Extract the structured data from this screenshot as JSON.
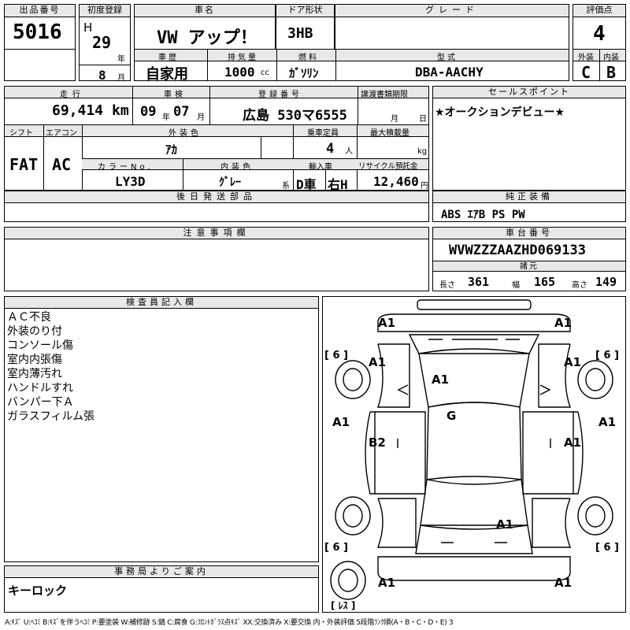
{
  "headers": {
    "lot_no": "出品番号",
    "first_reg": "初度登録",
    "car_name": "車名",
    "door": "ドア形状",
    "grade": "グレード",
    "score": "評価点",
    "history": "車歴",
    "displacement": "排気量",
    "fuel": "燃料",
    "model": "型式",
    "exterior": "外装",
    "interior": "内装",
    "mileage": "走行",
    "inspection": "車検",
    "reg_no": "登録番号",
    "transfer": "譲渡書類期限",
    "sales_point": "セールスポイント",
    "shift": "シフト",
    "aircon": "エアコン",
    "ext_color": "外装色",
    "capacity": "乗車定員",
    "max_load": "最大積載量",
    "color_no": "カラーNo.",
    "int_color": "内装色",
    "import": "輸入車",
    "recycle": "リサイクル預託金",
    "later_parts": "後日発送部品",
    "genuine_equip": "純正装備",
    "cautions": "注意事項欄",
    "chassis_no": "車台番号",
    "specs": "諸元",
    "inspector": "検査員記入欄",
    "office": "事務局よりご案内"
  },
  "lot_no": "5016",
  "era": "H",
  "year": "29",
  "year_unit": "年",
  "month": "8",
  "month_unit": "月",
  "car_name": "VW アップ！",
  "door": "3HB",
  "score": "4",
  "history": "自家用",
  "displacement": "1000",
  "displacement_unit": "cc",
  "fuel": "ｶﾞｿﾘﾝ",
  "model": "DBA-AACHY",
  "exterior_score": "C",
  "interior_score": "B",
  "mileage": "69,414",
  "mileage_unit": "km",
  "insp_year": "09",
  "insp_year_unit": "年",
  "insp_month": "07",
  "insp_month_unit": "月",
  "reg_no": "広島 530マ6555",
  "transfer_month_unit": "月",
  "transfer_day_unit": "日",
  "sales_point": "★オークションデビュー★",
  "shift": "FAT",
  "aircon": "AC",
  "ext_color": "ｱｶ",
  "capacity": "4",
  "capacity_unit": "人",
  "max_load_unit": "kg",
  "color_no": "LY3D",
  "int_color": "ｸﾞﾚｰ",
  "int_color_unit": "系",
  "import_side": "D車",
  "steering": "右H",
  "recycle": "12,460",
  "recycle_unit": "円",
  "genuine_equip": "ABS ｴｱB PS PW",
  "chassis_no": "WVWZZZAAZHD069133",
  "specs": {
    "length_label": "長さ",
    "length": "361",
    "width_label": "幅",
    "width": "165",
    "height_label": "高さ",
    "height": "149"
  },
  "inspector_notes": [
    "ＡＣ不良",
    "外装のり付",
    "コンソール傷",
    "室内内張傷",
    "室内薄汚れ",
    "ハンドルすれ",
    "バンパー下Ａ",
    "ガラスフィルム張"
  ],
  "office_note": "キーロック",
  "diagram": {
    "marks": [
      "A1",
      "A1",
      "A1",
      "A1",
      "A1",
      "G",
      "A1",
      "A1",
      "B2",
      "A1",
      "A1",
      "A1"
    ],
    "tire_labels": [
      "[ 6 ]",
      "[ 6 ]",
      "[ 6 ]",
      "[ 6 ]"
    ],
    "spare_label": "[ ﾚｽ ]"
  },
  "legend": "A:ｷｽﾞ U:ﾍｺﾐ B:ｷｽﾞを伴うﾍｺﾐ P:要塗装 W:補修跡 S:錆 C:腐食 G:ﾌﾛﾝﾄｶﾞﾗｽ点ｷｽﾞ XX:交換済み X:要交換 内・外装評価 5段階ﾗﾝｸ順(A・B・C・D・E) 3"
}
